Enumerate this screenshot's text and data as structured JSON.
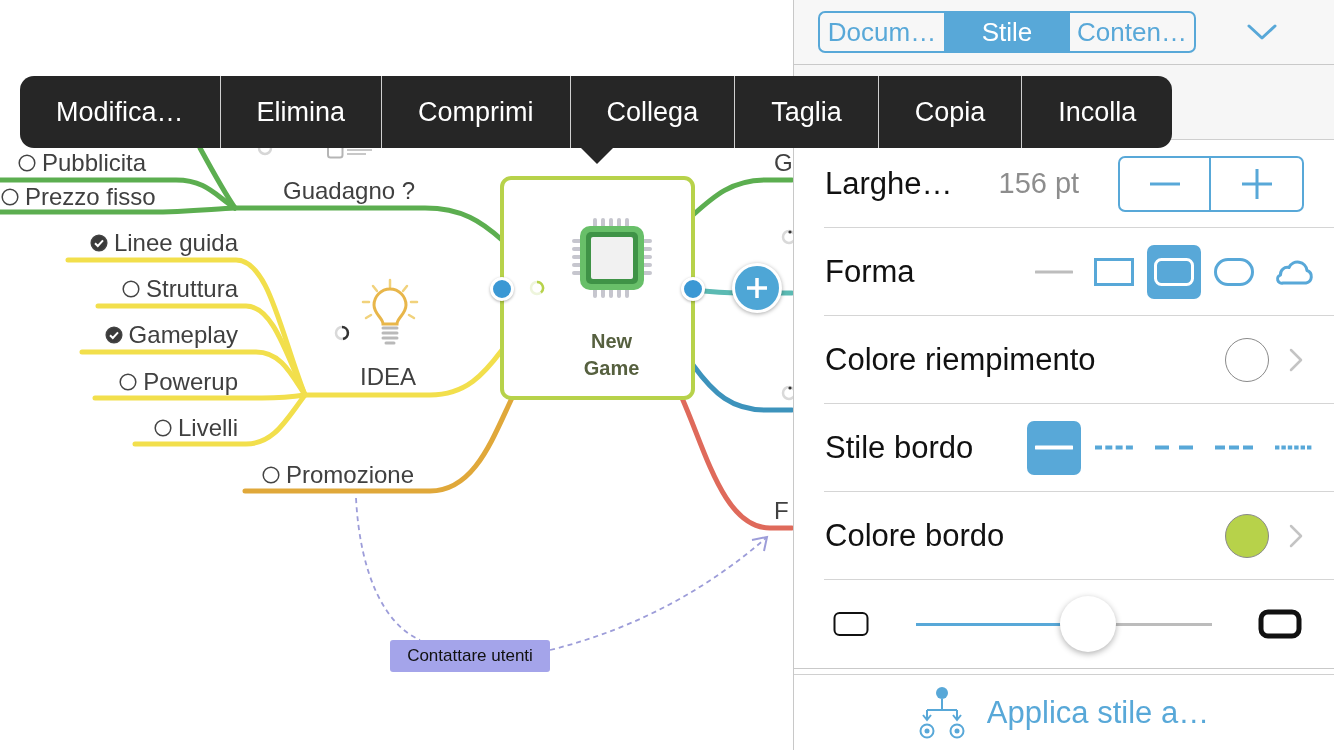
{
  "context_menu": {
    "items": [
      "Modifica…",
      "Elimina",
      "Comprimi",
      "Collega",
      "Taglia",
      "Copia",
      "Incolla"
    ]
  },
  "mind_map": {
    "central_topic": {
      "label": "New Game"
    },
    "branches": [
      {
        "label": "Guadagno ?",
        "color": "#5cae50",
        "children": [
          {
            "label": "Pubblicita",
            "checked": false
          },
          {
            "label": "Prezzo fisso",
            "checked": false
          }
        ]
      },
      {
        "label": "IDEA",
        "color": "#f2df4c",
        "children": [
          {
            "label": "Linee guida",
            "checked": true
          },
          {
            "label": "Struttura",
            "checked": false
          },
          {
            "label": "Gameplay",
            "checked": true
          },
          {
            "label": "Powerup",
            "checked": false
          },
          {
            "label": "Livelli",
            "checked": false
          }
        ]
      },
      {
        "label": "Promozione",
        "checked": false,
        "color": "#e0a83a"
      },
      {
        "label": "G",
        "color": "#5cae50"
      },
      {
        "color": "#5bbab3"
      },
      {
        "color": "#3d93bc"
      },
      {
        "label": "F",
        "color": "#df6a5b"
      }
    ],
    "relationship": {
      "label": "Contattare utenti"
    }
  },
  "inspector": {
    "tabs": [
      {
        "label": "Docum…",
        "selected": false
      },
      {
        "label": "Stile",
        "selected": true
      },
      {
        "label": "Conten…",
        "selected": false
      }
    ],
    "rows": [
      {
        "kind": "stepper",
        "label": "Larghe…",
        "value": "156 pt"
      },
      {
        "kind": "shape",
        "label": "Forma",
        "options": [
          {
            "kind": "none",
            "selected": false
          },
          {
            "kind": "rectangle",
            "selected": false
          },
          {
            "kind": "rounded",
            "selected": true
          },
          {
            "kind": "pill",
            "selected": false
          },
          {
            "kind": "cloud",
            "selected": false
          }
        ]
      },
      {
        "kind": "color",
        "label": "Colore riempimento",
        "color": "#ffffff"
      },
      {
        "kind": "border_style",
        "label": "Stile bordo",
        "options": [
          {
            "kind": "solid",
            "selected": true
          },
          {
            "kind": "short_dash",
            "selected": false
          },
          {
            "kind": "long_dash",
            "selected": false
          },
          {
            "kind": "dash",
            "selected": false
          },
          {
            "kind": "dot",
            "selected": false
          }
        ]
      },
      {
        "kind": "color",
        "label": "Colore bordo",
        "color": "#b7d24a"
      },
      {
        "kind": "slider",
        "level": 0.58
      }
    ],
    "apply_button": {
      "label": "Applica stile a…"
    }
  }
}
